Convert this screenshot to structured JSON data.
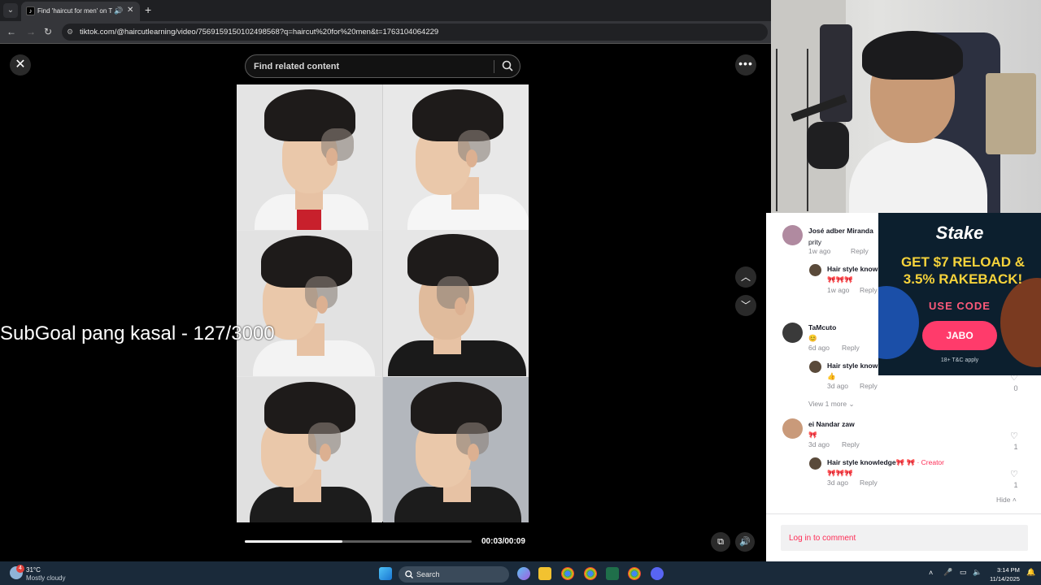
{
  "browser": {
    "tab_title": "Find 'haircut for men' on TikTok",
    "url": "tiktok.com/@haircutlearning/video/7569159150102498568?q=haircut%20for%20men&t=1763104064229"
  },
  "player": {
    "search_placeholder": "Find related content",
    "overlay_text": "SubGoal pang kasal - 127/3000",
    "time": "00:03/00:09",
    "progress": 0.43
  },
  "comments": [
    {
      "name": "José adber Miranda",
      "text": "prity",
      "meta": "1w ago",
      "reply": "Reply",
      "sub": {
        "name": "Hair style knowledge",
        "text": "🎀🎀🎀",
        "meta": "1w ago",
        "reply": "Reply"
      }
    },
    {
      "name": "TaMcuto",
      "text": "😊",
      "meta": "6d ago",
      "reply": "Reply",
      "sub": {
        "name": "Hair style knowledge",
        "text": "👍",
        "meta": "3d ago",
        "reply": "Reply",
        "likes": "0"
      },
      "view_more": "View 1 more"
    },
    {
      "name": "ei Nandar zaw",
      "text": "🎀",
      "meta": "3d ago",
      "reply": "Reply",
      "likes": "1",
      "sub": {
        "name": "Hair style knowledge🎀 🎀",
        "creator": " · Creator",
        "text": "🎀🎀🎀",
        "meta": "3d ago",
        "reply": "Reply",
        "likes": "1"
      }
    }
  ],
  "hide_label": "Hide",
  "login_label": "Log in to comment",
  "ad": {
    "brand": "Stake",
    "headline_1": "GET $7 RELOAD &",
    "headline_2": "3.5% RAKEBACK!",
    "use_code": "USE CODE",
    "code": "JABO",
    "terms": "18+ T&C apply"
  },
  "taskbar": {
    "temp": "31°C",
    "weather": "Mostly cloudy",
    "search": "Search",
    "time": "3:14 PM",
    "date": "11/14/2025",
    "badge": "4"
  },
  "colors": {
    "accent": "#fe2c55",
    "ad_bg": "#0c1f2e",
    "ad_gold": "#f6d33b"
  }
}
